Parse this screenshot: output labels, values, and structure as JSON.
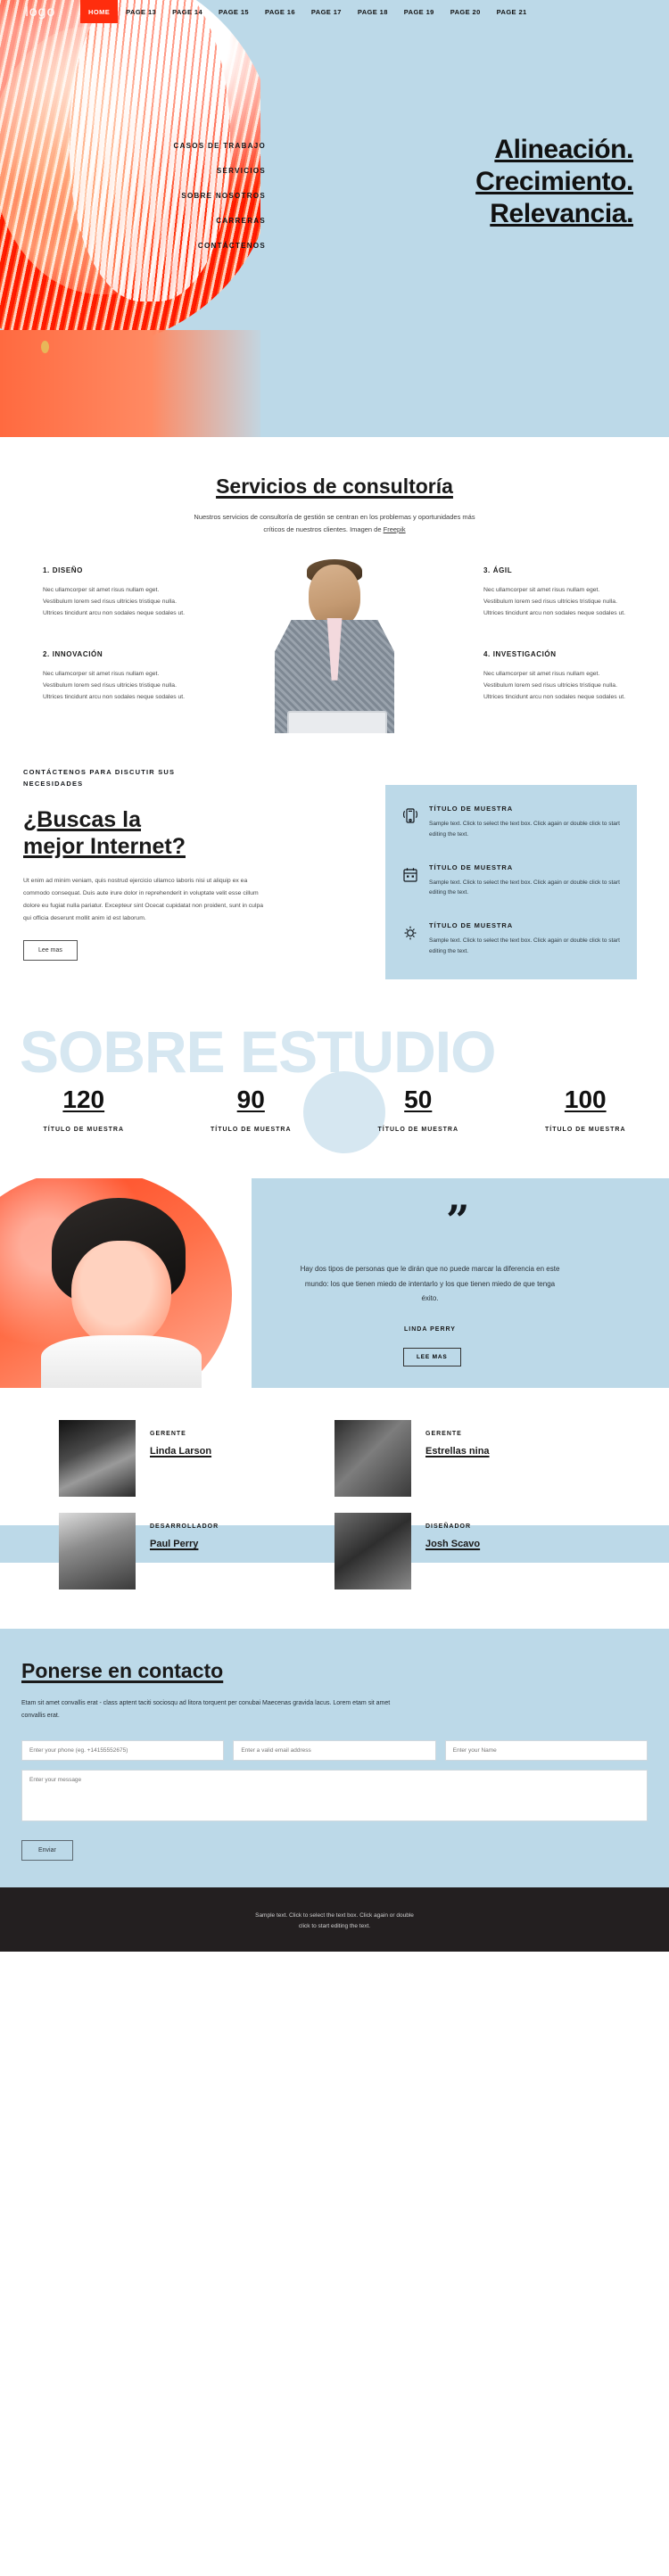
{
  "colors": {
    "accent_blue": "#bcd9e8",
    "accent_red": "#ff2d0d",
    "dark": "#231f20",
    "ghost_blue": "#d6e7f1"
  },
  "nav": {
    "logo": "logo",
    "items": [
      {
        "label": "HOME",
        "active": true
      },
      {
        "label": "PAGE 13"
      },
      {
        "label": "PAGE 14"
      },
      {
        "label": "PAGE 15"
      },
      {
        "label": "PAGE 16"
      },
      {
        "label": "PAGE 17"
      },
      {
        "label": "PAGE 18"
      },
      {
        "label": "PAGE 19"
      },
      {
        "label": "PAGE 20"
      },
      {
        "label": "PAGE 21"
      }
    ]
  },
  "hero": {
    "menu": [
      "CASOS DE TRABAJO",
      "SERVICIOS",
      "SOBRE NOSOTROS",
      "CARRERAS",
      "CONTÁCTENOS"
    ],
    "title_lines": [
      "Alineación.",
      "Crecimiento.",
      "Relevancia."
    ]
  },
  "services": {
    "title": "Servicios de consultoría",
    "subtitle": "Nuestros servicios de consultoría de gestión se centran en los problemas y oportunidades más críticos de nuestros clientes. Imagen de ",
    "subtitle_link": "Freepik",
    "body": "Nec ullamcorper sit amet risus nullam eget. Vestibulum lorem sed risus ultricies tristique nulla. Ultrices tincidunt arcu non sodales neque sodales ut.",
    "items": [
      {
        "heading": "1. DISEÑO"
      },
      {
        "heading": "2. INNOVACIÓN"
      },
      {
        "heading": "3. ÁGIL"
      },
      {
        "heading": "4. INVESTIGACIÓN"
      }
    ]
  },
  "internet": {
    "eyebrow": "CONTÁCTENOS PARA DISCUTIR SUS NECESIDADES",
    "heading": "¿Buscas la mejor Internet?",
    "paragraph": "Ut enim ad minim veniam, quis nostrud ejercicio ullamco laboris nisi ut aliquip ex ea commodo consequat. Duis aute irure dolor in reprehenderit in voluptate velit esse cillum dolore eu fugiat nulla pariatur. Excepteur sint Ocecat cupidatat non proident, sunt in culpa qui officia deserunt mollit anim id est laborum.",
    "button": "Lee mas",
    "cards": [
      {
        "icon": "mobile-signal-icon",
        "heading": "TÍTULO DE MUESTRA",
        "text": "Sample text. Click to select the text box. Click again or double click to start editing the text."
      },
      {
        "icon": "calendar-icon",
        "heading": "TÍTULO DE MUESTRA",
        "text": "Sample text. Click to select the text box. Click again or double click to start editing the text."
      },
      {
        "icon": "gear-icon",
        "heading": "TÍTULO DE MUESTRA",
        "text": "Sample text. Click to select the text box. Click again or double click to start editing the text."
      }
    ]
  },
  "stats": {
    "ghost_text": "SOBRE ESTUDIO",
    "items": [
      {
        "number": "120",
        "label": "TÍTULO DE MUESTRA"
      },
      {
        "number": "90",
        "label": "TÍTULO DE MUESTRA"
      },
      {
        "number": "50",
        "label": "TÍTULO DE MUESTRA"
      },
      {
        "number": "100",
        "label": "TÍTULO DE MUESTRA"
      }
    ]
  },
  "testimonial": {
    "mark": "”",
    "quote": "Hay dos tipos de personas que le dirán que no puede marcar la diferencia en este mundo: los que tienen miedo de intentarlo y los que tienen miedo de que tenga éxito.",
    "author": "LINDA PERRY",
    "button": "LEE MAS"
  },
  "team": {
    "members": [
      {
        "role": "GERENTE",
        "name": "Linda Larson"
      },
      {
        "role": "GERENTE",
        "name": "Estrellas nina"
      },
      {
        "role": "DESARROLLADOR",
        "name": "Paul Perry"
      },
      {
        "role": "DISEÑADOR",
        "name": "Josh Scavo"
      }
    ]
  },
  "contact": {
    "title": "Ponerse en contacto",
    "paragraph": "Etam sit amet convallis erat - class aptent taciti sociosqu ad litora torquent per conubai Maecenas gravida lacus. Lorem etam sit amet convallis erat.",
    "fields": [
      {
        "placeholder": "Enter your phone (eg. +14155552675)"
      },
      {
        "placeholder": "Enter a valid email address"
      },
      {
        "placeholder": "Enter your Name"
      }
    ],
    "message_placeholder": "Enter your message",
    "submit": "Enviar"
  },
  "footer": {
    "line1": "Sample text. Click to select the text box. Click again or double",
    "line2": "click to start editing the text."
  }
}
